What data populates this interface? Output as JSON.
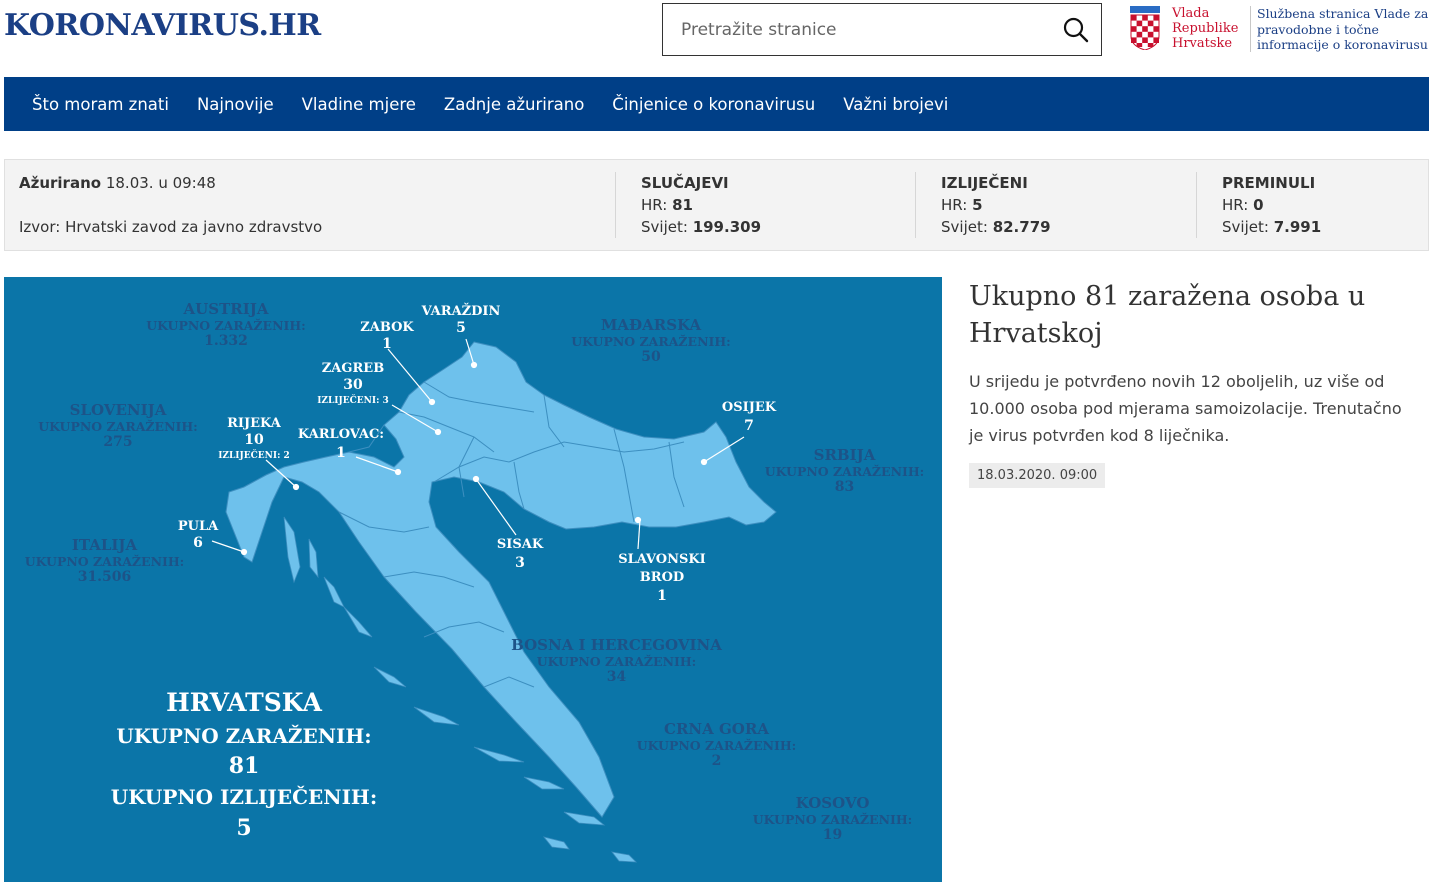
{
  "site": {
    "logo": "KORONAVIRUS.HR"
  },
  "search": {
    "placeholder": "Pretražite stranice",
    "icon": "search-icon"
  },
  "gov": {
    "name": "Vlada Republike Hrvatske",
    "description": "Službena stranica Vlade za pravodobne i točne informacije o koronavirusu",
    "crest_icon": "croatian-coat-of-arms-icon"
  },
  "nav": {
    "items": [
      "Što moram znati",
      "Najnovije",
      "Vladine mjere",
      "Zadnje ažurirano",
      "Činjenice o koronavirusu",
      "Važni brojevi"
    ]
  },
  "stats": {
    "updated_label": "Ažurirano",
    "updated_value": "18.03. u 09:48",
    "source": "Izvor: Hrvatski zavod za javno zdravstvo",
    "groups": [
      {
        "title": "SLUČAJEVI",
        "hr_label": "HR:",
        "hr": "81",
        "world_label": "Svijet:",
        "world": "199.309"
      },
      {
        "title": "IZLIJEČENI",
        "hr_label": "HR:",
        "hr": "5",
        "world_label": "Svijet:",
        "world": "82.779"
      },
      {
        "title": "PREMINULI",
        "hr_label": "HR:",
        "hr": "0",
        "world_label": "Svijet:",
        "world": "7.991"
      }
    ]
  },
  "map": {
    "countries": [
      {
        "name": "AUSTRIJA",
        "sub": "UKUPNO ZARAŽENIH:",
        "num": "1.332"
      },
      {
        "name": "MAĐARSKA",
        "sub": "UKUPNO ZARAŽENIH:",
        "num": "50"
      },
      {
        "name": "SLOVENIJA",
        "sub": "UKUPNO ZARAŽENIH:",
        "num": "275"
      },
      {
        "name": "SRBIJA",
        "sub": "UKUPNO ZARAŽENIH:",
        "num": "83"
      },
      {
        "name": "ITALIJA",
        "sub": "UKUPNO ZARAŽENIH:",
        "num": "31.506"
      },
      {
        "name": "BOSNA I HERCEGOVINA",
        "sub": "UKUPNO ZARAŽENIH:",
        "num": "34"
      },
      {
        "name": "CRNA GORA",
        "sub": "UKUPNO ZARAŽENIH:",
        "num": "2"
      },
      {
        "name": "KOSOVO",
        "sub": "UKUPNO ZARAŽENIH:",
        "num": "19"
      }
    ],
    "cities": [
      {
        "name": "VARAŽDIN",
        "num": "5",
        "sub": ""
      },
      {
        "name": "ZABOK",
        "num": "1",
        "sub": ""
      },
      {
        "name": "ZAGREB",
        "num": "30",
        "sub": "IZLIJEČENI: 3"
      },
      {
        "name": "RIJEKA",
        "num": "10",
        "sub": "IZLIJEČENI: 2"
      },
      {
        "name": "KARLOVAC:",
        "num": "1",
        "sub": ""
      },
      {
        "name": "OSIJEK",
        "num": "7",
        "sub": ""
      },
      {
        "name": "PULA",
        "num": "6",
        "sub": ""
      },
      {
        "name": "SISAK",
        "num": "3",
        "sub": ""
      },
      {
        "name": "SLAVONSKI BROD",
        "num": "1",
        "sub": ""
      }
    ],
    "summary": {
      "country": "HRVATSKA",
      "infected_label": "UKUPNO ZARAŽENIH:",
      "infected": "81",
      "recovered_label": "UKUPNO IZLIJEČENIH:",
      "recovered": "5"
    },
    "colors": {
      "sea": "#0b75a8",
      "land": "#6ec1ec",
      "label": "#1d5388"
    }
  },
  "article": {
    "title": "Ukupno 81 zaražena osoba u Hrvatskoj",
    "body": "U srijedu je potvrđeno novih 12 oboljelih, uz više od 10.000 osoba pod mjerama samoizolacije. Trenutačno je virus potvrđen kod 8 liječnika.",
    "date": "18.03.2020. 09:00"
  },
  "colors": {
    "brand": "#1b3f85",
    "nav": "#003f87",
    "gov_red": "#c8102e"
  }
}
